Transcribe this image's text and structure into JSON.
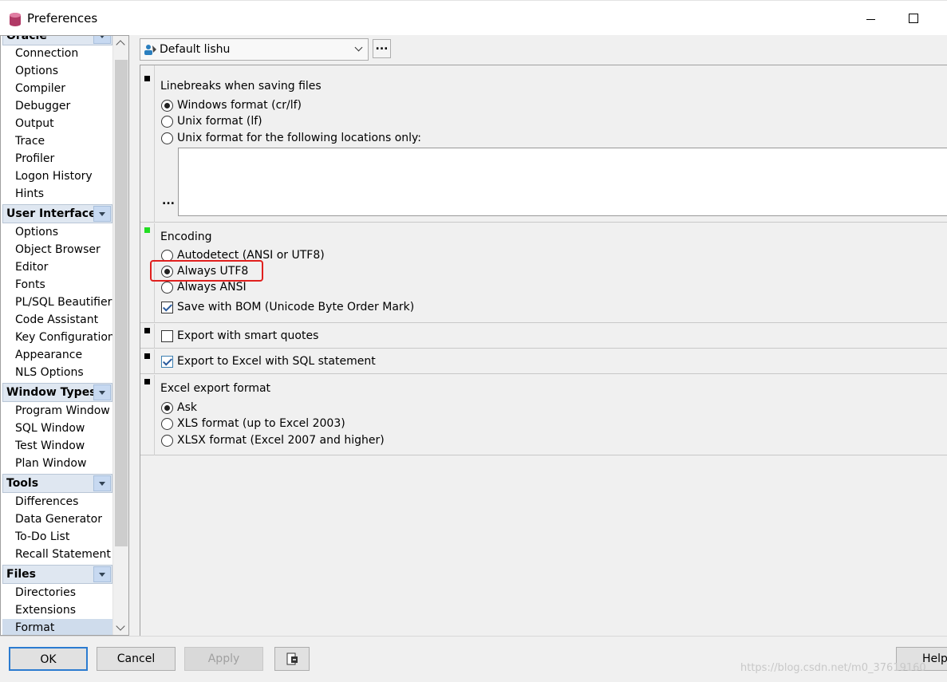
{
  "window": {
    "title": "Preferences"
  },
  "sidebar": {
    "groups": [
      {
        "label": "Oracle",
        "items": [
          "Connection",
          "Options",
          "Compiler",
          "Debugger",
          "Output",
          "Trace",
          "Profiler",
          "Logon History",
          "Hints"
        ]
      },
      {
        "label": "User Interface",
        "items": [
          "Options",
          "Object Browser",
          "Editor",
          "Fonts",
          "PL/SQL Beautifier",
          "Code Assistant",
          "Key Configuration",
          "Appearance",
          "NLS Options"
        ]
      },
      {
        "label": "Window Types",
        "items": [
          "Program Window",
          "SQL Window",
          "Test Window",
          "Plan Window"
        ]
      },
      {
        "label": "Tools",
        "items": [
          "Differences",
          "Data Generator",
          "To-Do List",
          "Recall Statement"
        ]
      },
      {
        "label": "Files",
        "items": [
          "Directories",
          "Extensions",
          "Format"
        ]
      }
    ],
    "selected": "Format"
  },
  "profile": {
    "value": "Default lishu",
    "more_label": "..."
  },
  "linebreaks": {
    "title": "Linebreaks when saving files",
    "options": [
      "Windows format (cr/lf)",
      "Unix format (lf)",
      "Unix format for the following locations only:"
    ],
    "selected": 0,
    "ellipsis": "..."
  },
  "encoding": {
    "title": "Encoding",
    "options": [
      "Autodetect (ANSI or UTF8)",
      "Always UTF8",
      "Always ANSI"
    ],
    "selected": 1,
    "bom_label": "Save with BOM (Unicode Byte Order Mark)",
    "bom_checked": true
  },
  "smart_quotes": {
    "label": "Export with smart quotes",
    "checked": false
  },
  "excel_sql": {
    "label": "Export to Excel with SQL statement",
    "checked": true
  },
  "excel_format": {
    "title": "Excel export format",
    "options": [
      "Ask",
      "XLS format (up to Excel 2003)",
      "XLSX format (Excel 2007 and higher)"
    ],
    "selected": 0
  },
  "buttons": {
    "ok": "OK",
    "cancel": "Cancel",
    "apply": "Apply",
    "help": "Help"
  },
  "watermark": "https://blog.csdn.net/m0_37619160"
}
